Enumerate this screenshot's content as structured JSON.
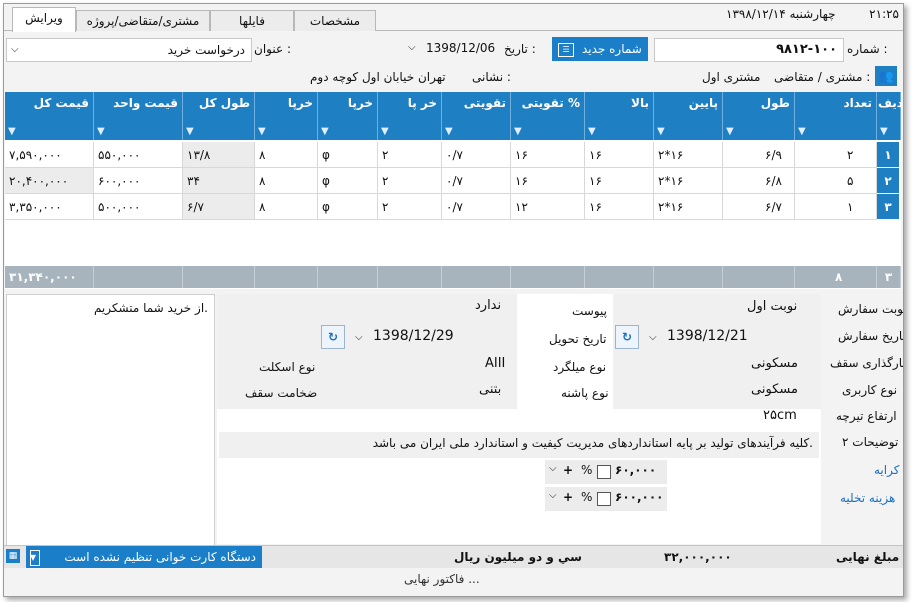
{
  "tabs": [
    {
      "label": "ويرايش",
      "active": true
    },
    {
      "label": "مشتری/متقاضی/پروژه",
      "active": false
    },
    {
      "label": "فایلها",
      "active": false
    },
    {
      "label": "مشخصات",
      "active": false
    }
  ],
  "clock": "۲۱:۲۵",
  "date_line": "چهارشنبه  ۱۳۹۸/۱۲/۱۴",
  "header": {
    "number_label": "شماره :",
    "number_value": "۹۸۱۲-۱۰۰",
    "new_number_button": "شماره جدید",
    "date_label": "تاریخ :",
    "date_value": "1398/12/06",
    "title_label": "عنوان :",
    "title_value": "درخواست خرید",
    "customer_label": "مشتری / متقاضی :",
    "customer_value": "مشتری اول",
    "address_label": "نشانی :",
    "address_value": "تهران خیابان اول کوچه دوم"
  },
  "grid": {
    "columns": [
      "ردیف",
      "تعداد",
      "طول",
      "پایین",
      "بالا",
      "تقویتی %",
      "تقویتی",
      "خر پا",
      "خرپا",
      "خرپا",
      "طول کل",
      "قیمت واحد",
      "قیمت کل"
    ],
    "rows": [
      [
        "۱",
        "۲",
        "۶/۹",
        "۲*۱۶",
        "۱۶",
        "۱۶",
        "۰/۷",
        "۲",
        "φ",
        "۸",
        "۱۳/۸",
        "۵۵۰,۰۰۰",
        "۷,۵۹۰,۰۰۰"
      ],
      [
        "۲",
        "۵",
        "۶/۸",
        "۲*۱۶",
        "۱۶",
        "۱۶",
        "۰/۷",
        "۲",
        "φ",
        "۸",
        "۳۴",
        "۶۰۰,۰۰۰",
        "۲۰,۴۰۰,۰۰۰"
      ],
      [
        "۳",
        "۱",
        "۶/۷",
        "۲*۱۶",
        "۱۶",
        "۱۲",
        "۰/۷",
        "۲",
        "φ",
        "۸",
        "۶/۷",
        "۵۰۰,۰۰۰",
        "۳,۳۵۰,۰۰۰"
      ]
    ],
    "footer_count": "۳",
    "footer_qty": "۸",
    "footer_total": "۳۱,۳۴۰,۰۰۰"
  },
  "notes_text": "از خرید شما متشکریم.",
  "form": {
    "order_turn_label": "نوبت سفارش",
    "order_turn_value": "نوبت اول",
    "order_date_label": "تاریخ سفارش",
    "order_date_value": "1398/12/21",
    "roof_load_label": "بارگذاری سقف",
    "roof_load_value": "مسکونی",
    "usage_label": "نوع کاربری",
    "usage_value": "مسکونی",
    "joist_height_label": "ارتفاع تیرچه",
    "joist_height_value": "۲۵cm",
    "desc2_label": "توضیحات ۲",
    "desc2_value": "کلیه فرآیندهای تولید بر پایه استانداردهای مدیریت کیفیت و استاندارد ملی ایران می باشد.",
    "attached_label": "پیوست",
    "attached_value": "ندارد",
    "delivery_label": "تاریخ تحویل",
    "delivery_value": "1398/12/29",
    "rebar_label": "نوع میلگرد",
    "rebar_value": "AIII",
    "heel_label": "نوع پاشنه",
    "heel_value": "بتنی",
    "skeleton_label": "نوع اسکلت",
    "thickness_label": "ضخامت سقف",
    "rent_label": "کرایه",
    "rent_value": "۶۰,۰۰۰",
    "unload_label": "هزینه تخلیه",
    "unload_value": "۶۰۰,۰۰۰",
    "percent_sign": "%",
    "plus_sign": "+"
  },
  "status": {
    "final_label": "مبلغ نهایی :",
    "final_value": "۳۲,۰۰۰,۰۰۰",
    "words": "سي و دو ميليون  ريال",
    "card_reader": "دستگاه کارت خوانی تنظیم نشده است"
  },
  "bottom_partial": "فاکتور نهایی ...",
  "colors": {
    "accent": "#1e7fc3",
    "footer": "#a7b3bd"
  }
}
